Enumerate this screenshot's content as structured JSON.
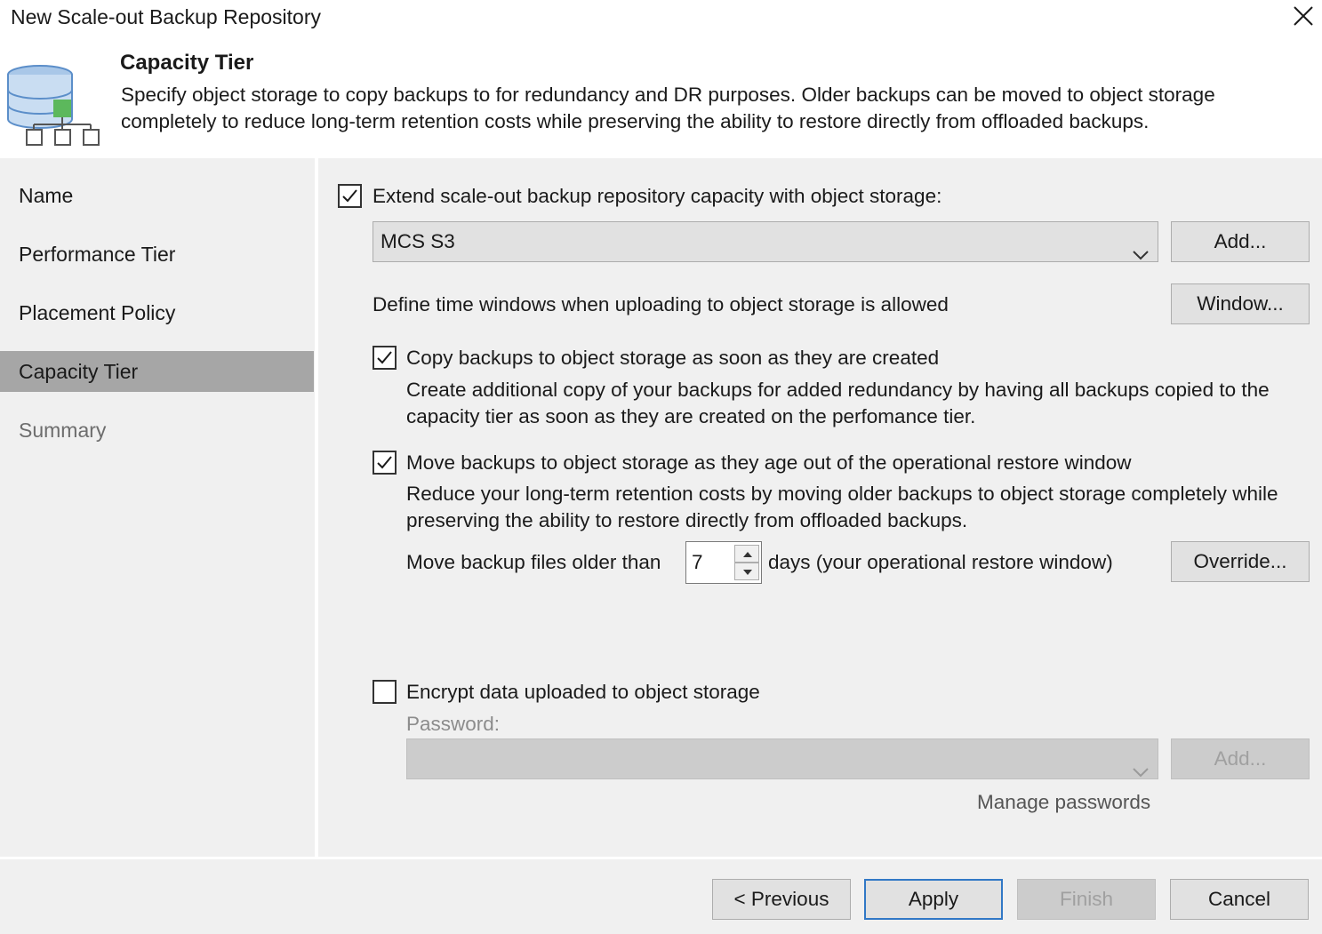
{
  "window": {
    "title": "New Scale-out Backup Repository"
  },
  "header": {
    "title": "Capacity Tier",
    "description": "Specify object storage to copy backups to for redundancy and DR purposes. Older backups can be moved to object storage completely to reduce long-term retention costs while preserving the ability to restore directly from offloaded backups.",
    "icon": "database-network-icon"
  },
  "sidebar": {
    "items": [
      {
        "label": "Name",
        "state": "normal"
      },
      {
        "label": "Performance Tier",
        "state": "normal"
      },
      {
        "label": "Placement Policy",
        "state": "normal"
      },
      {
        "label": "Capacity Tier",
        "state": "active"
      },
      {
        "label": "Summary",
        "state": "inactive"
      }
    ]
  },
  "main": {
    "extend": {
      "label": "Extend scale-out backup repository capacity with object storage:",
      "checked": true
    },
    "object_storage": {
      "value": "MCS S3",
      "add_label": "Add..."
    },
    "window_row": {
      "label": "Define time windows when uploading to object storage is allowed",
      "button": "Window..."
    },
    "copy": {
      "label": "Copy backups to object storage as soon as they are created",
      "checked": true,
      "description": "Create additional copy of your backups for added redundancy by having all backups copied to the capacity tier as soon as they are created on the perfomance tier."
    },
    "move": {
      "label": "Move backups to object storage as they age out of the operational restore window",
      "checked": true,
      "description": "Reduce your long-term retention costs by moving older backups to object storage completely while preserving the ability to restore directly from offloaded backups.",
      "older_than_label": "Move backup files older than",
      "days_value": "7",
      "days_suffix": "days (your operational restore window)",
      "override_label": "Override..."
    },
    "encrypt": {
      "label": "Encrypt data uploaded to object storage",
      "checked": false,
      "password_label": "Password:",
      "password_value": "",
      "add_label": "Add...",
      "manage_link": "Manage passwords"
    }
  },
  "footer": {
    "previous": "< Previous",
    "apply": "Apply",
    "finish": "Finish",
    "cancel": "Cancel"
  },
  "colors": {
    "active_nav": "#a6a6a6",
    "panel": "#f0f0f0",
    "default_button_border": "#3178c6",
    "icon_green": "#5cb85c",
    "icon_blue": "#5b8ec9"
  }
}
